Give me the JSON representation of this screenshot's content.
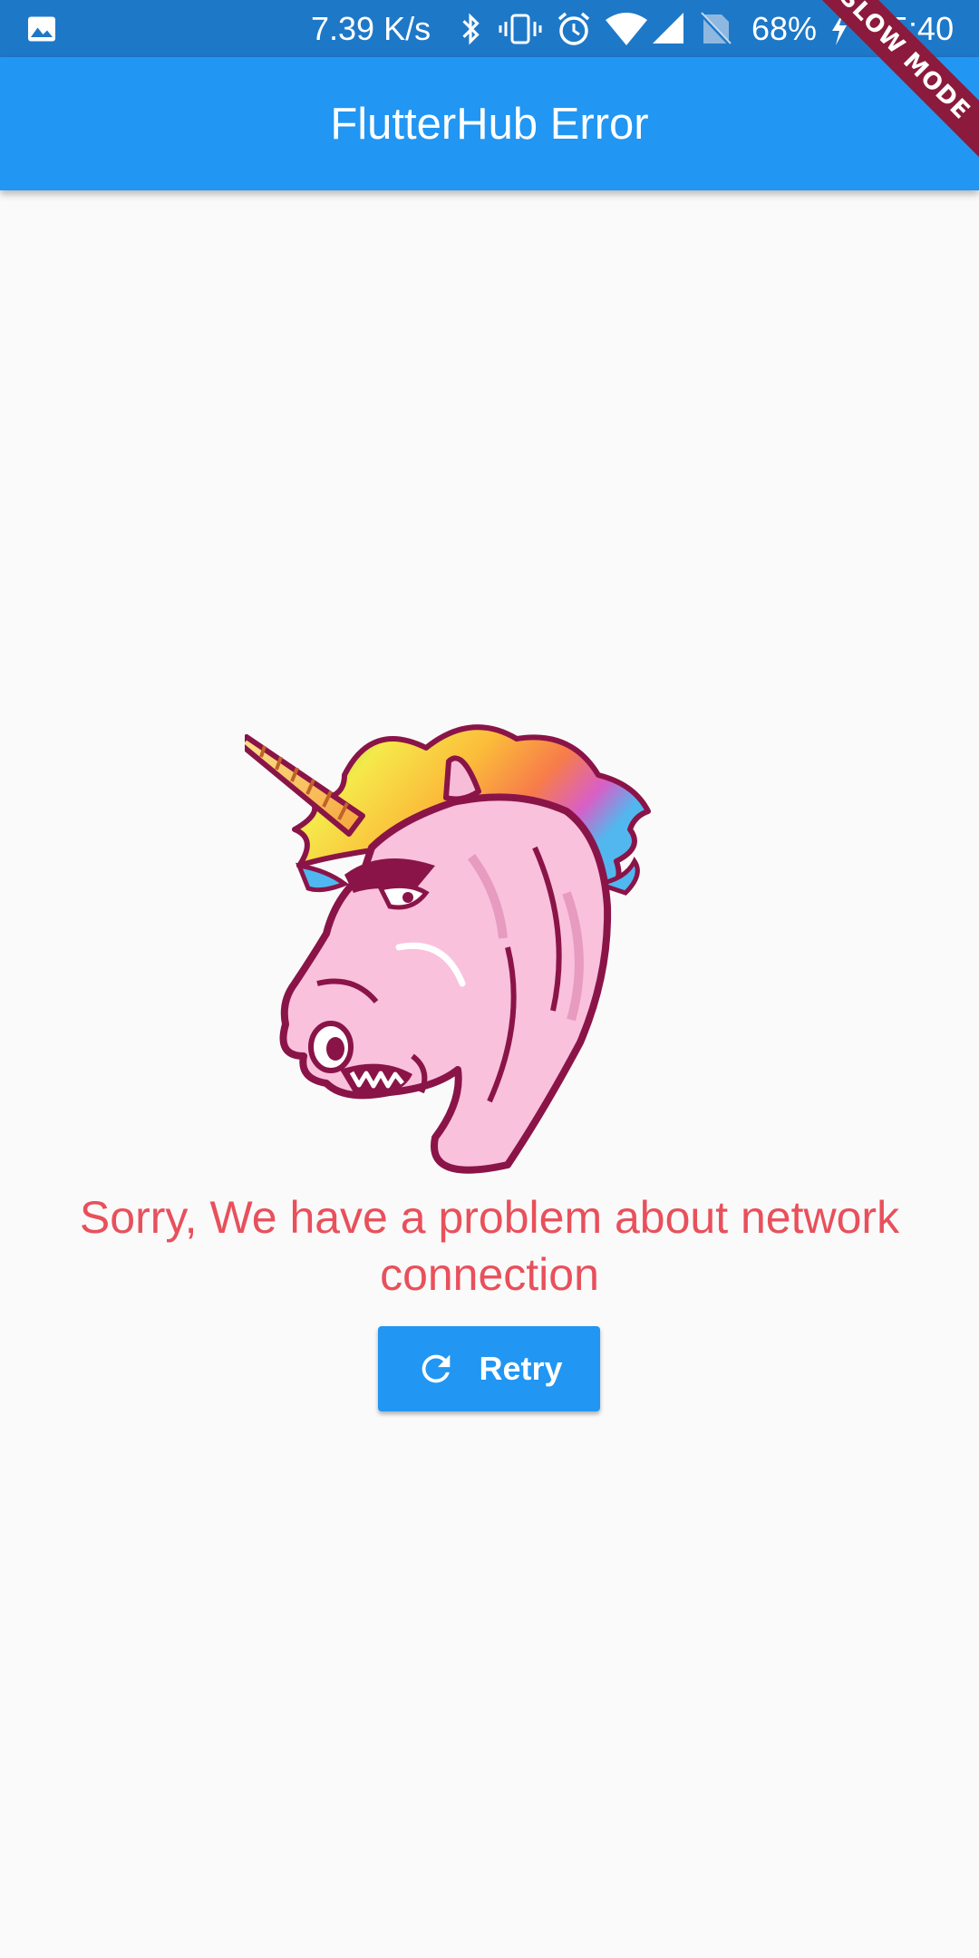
{
  "status_bar": {
    "net_speed": "7.39 K/s",
    "battery": "68%",
    "time": "15:40",
    "icons": [
      "gallery-icon",
      "bluetooth-icon",
      "vibrate-icon",
      "alarm-icon",
      "wifi-icon",
      "signal-icon",
      "no-sim-icon",
      "charging-icon"
    ]
  },
  "app_bar": {
    "title": "FlutterHub Error"
  },
  "debug_banner": {
    "label": "SLOW MODE"
  },
  "error": {
    "image": "unicorn-illustration",
    "message": "Sorry, We have a problem about network connection",
    "retry_label": "Retry",
    "retry_icon": "refresh-icon"
  },
  "colors": {
    "status_bar": "#1e78c8",
    "app_bar": "#2196f3",
    "message_text": "#e8505b",
    "button": "#2196f3",
    "background": "#fafafa",
    "banner": "#8b1a3c"
  }
}
